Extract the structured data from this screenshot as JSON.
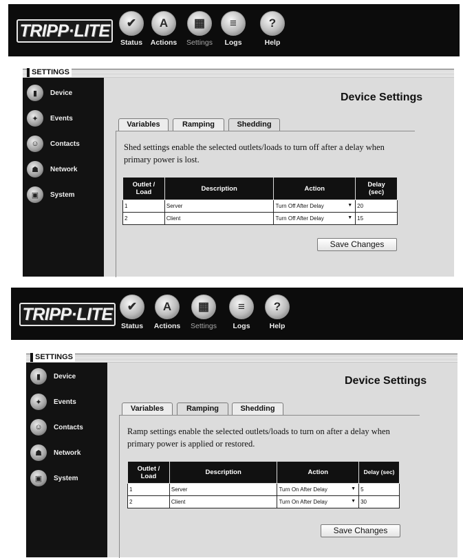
{
  "header": {
    "logo": "TRIPP·LITE",
    "nav": [
      {
        "label": "Status",
        "icon": "status-icon",
        "glyph": "✔"
      },
      {
        "label": "Actions",
        "icon": "actions-icon",
        "glyph": "A"
      },
      {
        "label": "Settings",
        "icon": "settings-icon",
        "glyph": "▦"
      },
      {
        "label": "Logs",
        "icon": "logs-icon",
        "glyph": "≡"
      },
      {
        "label": "Help",
        "icon": "help-icon",
        "glyph": "?"
      }
    ]
  },
  "section_label": "SETTINGS",
  "sidebar": {
    "items": [
      {
        "label": "Device",
        "icon": "device-icon",
        "glyph": "▮"
      },
      {
        "label": "Events",
        "icon": "events-icon",
        "glyph": "✦"
      },
      {
        "label": "Contacts",
        "icon": "contacts-icon",
        "glyph": "☺"
      },
      {
        "label": "Network",
        "icon": "network-icon",
        "glyph": "☗"
      },
      {
        "label": "System",
        "icon": "system-icon",
        "glyph": "▣"
      }
    ]
  },
  "page_title": "Device Settings",
  "tabs": [
    "Variables",
    "Ramping",
    "Shedding"
  ],
  "table_headers": {
    "outlet_line1": "Outlet /",
    "outlet_line2": "Load",
    "description": "Description",
    "action": "Action"
  },
  "save_label": "Save Changes",
  "screen1": {
    "active_tab": "Shedding",
    "description_text": "Shed settings enable the selected outlets/loads to turn off after a delay when primary power is lost.",
    "delay_header_line1": "Delay",
    "delay_header_line2": "(sec)",
    "rows": [
      {
        "outlet": "1",
        "description": "Server",
        "action": "Turn Off After Delay",
        "delay": "20"
      },
      {
        "outlet": "2",
        "description": "Client",
        "action": "Turn Off After Delay",
        "delay": "15"
      }
    ]
  },
  "screen2": {
    "active_tab": "Ramping",
    "description_text": "Ramp settings enable the selected outlets/loads to turn on after a delay when primary power is applied or restored.",
    "delay_header": "Delay (sec)",
    "rows": [
      {
        "outlet": "1",
        "description": "Server",
        "action": "Turn On After Delay",
        "delay": "5"
      },
      {
        "outlet": "2",
        "description": "Client",
        "action": "Turn On After Delay",
        "delay": "30"
      }
    ]
  }
}
